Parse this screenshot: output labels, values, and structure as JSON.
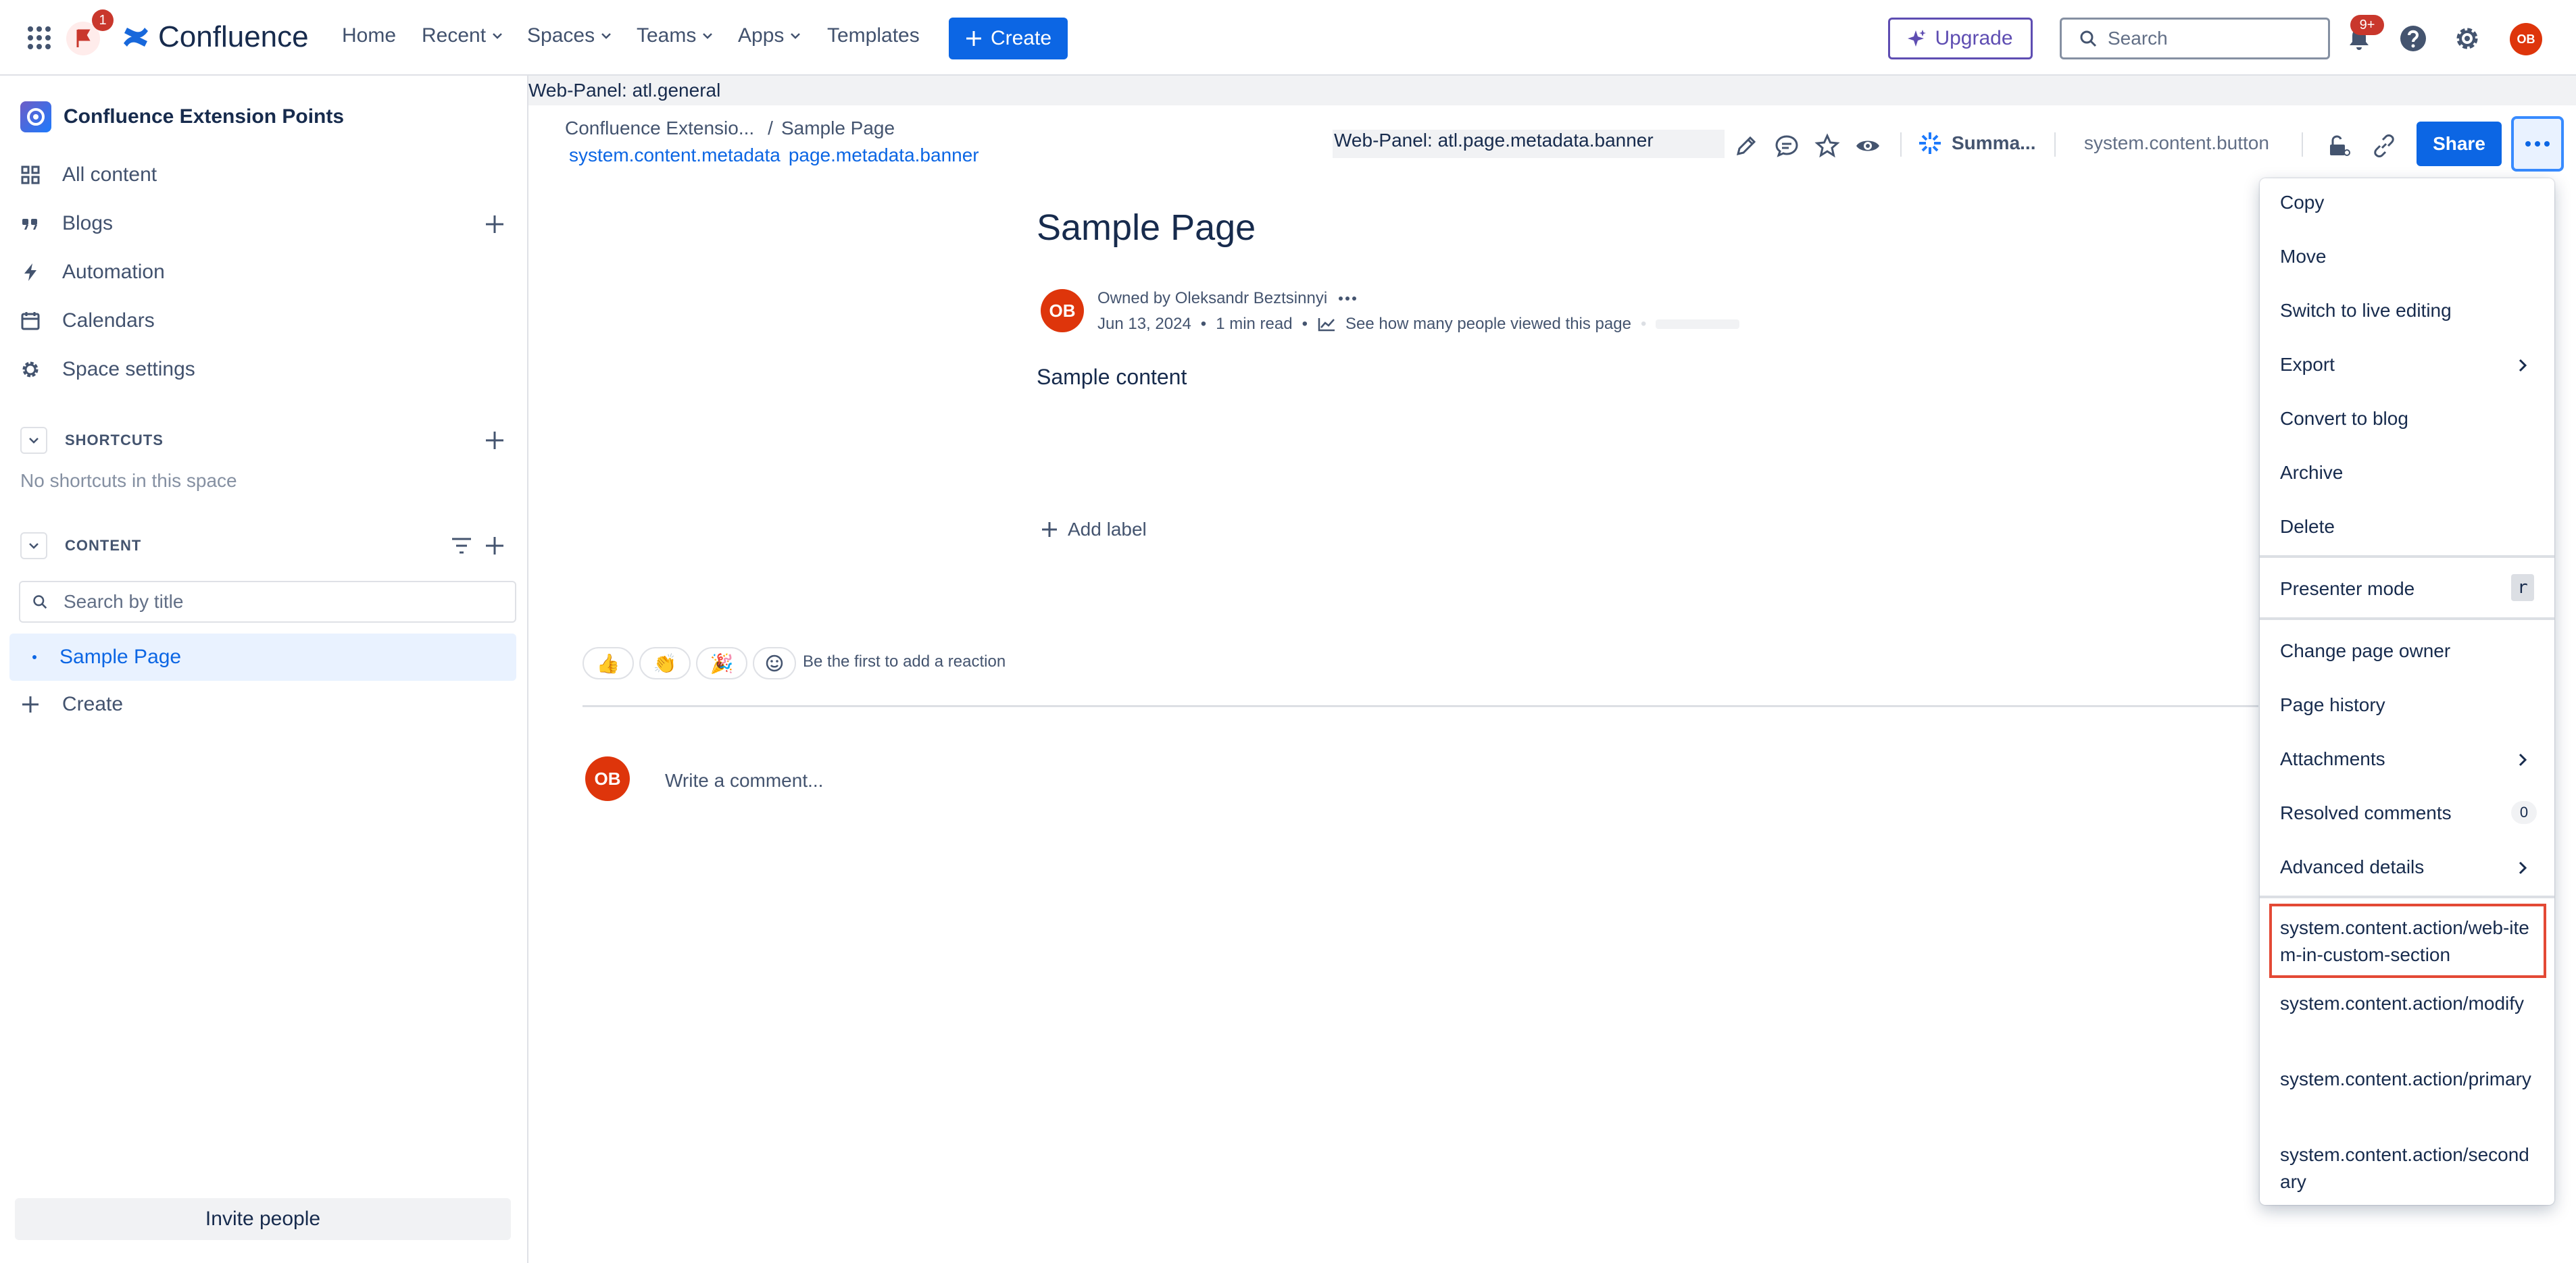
{
  "topbar": {
    "notification_count": "1",
    "logo_text": "Confluence",
    "nav": [
      {
        "label": "Home"
      },
      {
        "label": "Recent"
      },
      {
        "label": "Spaces"
      },
      {
        "label": "Teams"
      },
      {
        "label": "Apps"
      },
      {
        "label": "Templates"
      }
    ],
    "create_label": "Create",
    "upgrade_label": "Upgrade",
    "search_placeholder": "Search",
    "bell_badge": "9+",
    "avatar_initials": "OB"
  },
  "sidebar": {
    "space_name": "Confluence Extension Points",
    "items": [
      {
        "label": "All content",
        "icon": "grid-icon"
      },
      {
        "label": "Blogs",
        "icon": "quote-icon"
      },
      {
        "label": "Automation",
        "icon": "bolt-icon"
      },
      {
        "label": "Calendars",
        "icon": "calendar-icon"
      },
      {
        "label": "Space settings",
        "icon": "gear-icon"
      }
    ],
    "shortcuts_heading": "SHORTCUTS",
    "no_shortcuts": "No shortcuts in this space",
    "content_heading": "CONTENT",
    "search_placeholder": "Search by title",
    "tree_item": "Sample Page",
    "create_label": "Create",
    "invite_label": "Invite people"
  },
  "webpanel_general": "Web-Panel: atl.general",
  "breadcrumb": {
    "space": "Confluence Extensio...",
    "separator": "/",
    "page": "Sample Page"
  },
  "metadata_links": [
    "system.content.metadata",
    "page.metadata.banner"
  ],
  "header_actions": {
    "webpanel_banner": "Web-Panel: atl.page.metadata.banner",
    "summarize": "Summa...",
    "content_button": "system.content.button",
    "share": "Share"
  },
  "page": {
    "title": "Sample Page",
    "avatar_initials": "OB",
    "owner": "Owned by Oleksandr Beztsinnyi",
    "date": "Jun 13, 2024",
    "dot": "•",
    "read_time": "1 min read",
    "views_link": "See how many people viewed this page",
    "body": "Sample content",
    "add_label": "Add label",
    "reactions": [
      "👍",
      "👏",
      "🎉"
    ],
    "reaction_prompt": "Be the first to add a reaction",
    "comment_placeholder": "Write a comment..."
  },
  "menu": {
    "items": [
      "Copy",
      "Move",
      "Switch to live editing",
      "Export",
      "Convert to blog",
      "Archive",
      "Delete"
    ],
    "presenter_mode": "Presenter mode",
    "presenter_shortcut": "r",
    "items2": [
      "Change page owner",
      "Page history",
      "Attachments",
      "Resolved comments",
      "Advanced details"
    ],
    "resolved_count": "0",
    "ext_items": [
      "system.content.action/web-item-in-custom-section",
      "system.content.action/modify",
      "system.content.action/primary",
      "system.content.action/secondary"
    ]
  },
  "colors": {
    "brand": "#0c66e4",
    "highlight": "#e34935",
    "badge": "#c9372c"
  }
}
